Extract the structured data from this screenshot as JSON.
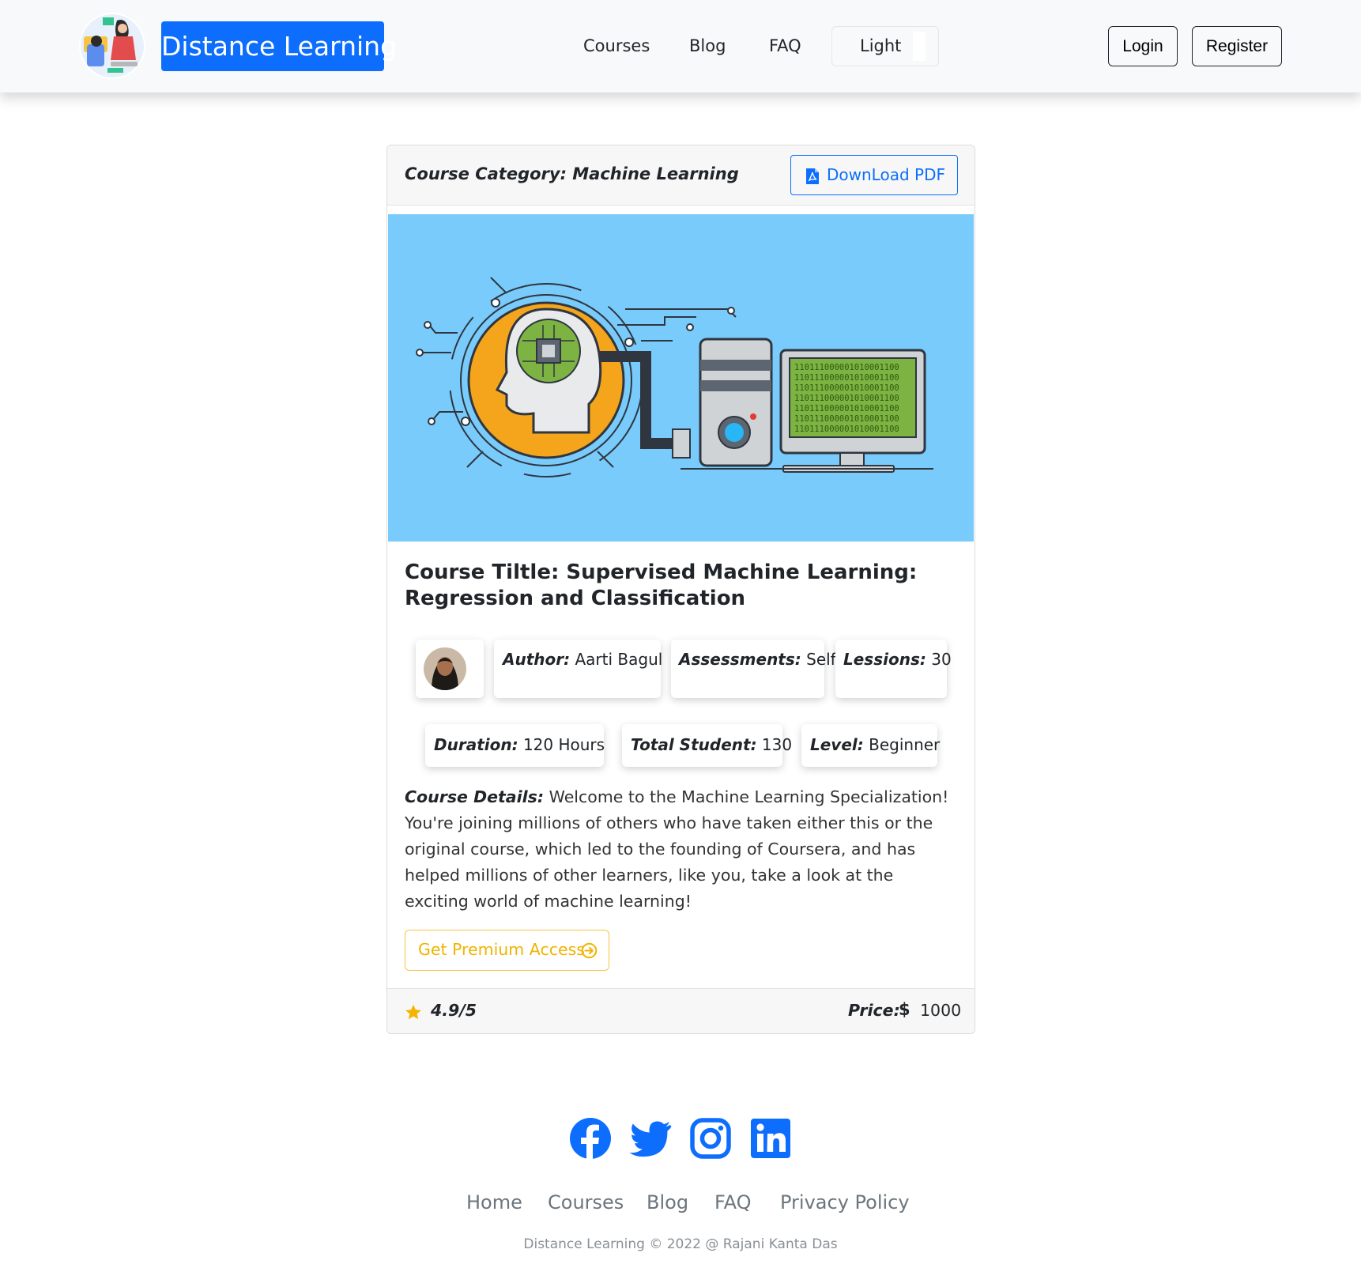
{
  "navbar": {
    "brand": "Distance Learning",
    "links": [
      "Courses",
      "Blog",
      "FAQ"
    ],
    "theme_label": "Light",
    "login_label": "Login",
    "register_label": "Register"
  },
  "course": {
    "category_label": "Course Category: Machine Learning",
    "download_label": "DownLoad PDF",
    "title": "Course Tiltle: Supervised Machine Learning: Regression and Classification",
    "author_key": "Author:",
    "author_val": "Aarti Bagul",
    "assessments_key": "Assessments:",
    "assessments_val": "Self",
    "lessons_key": "Lessions:",
    "lessons_val": "30",
    "duration_key": "Duration:",
    "duration_val": "120 Hours",
    "students_key": "Total Student:",
    "students_val": "130",
    "level_key": "Level:",
    "level_val": "Beginner",
    "details_key": "Course Details:",
    "details_text": "Welcome to the Machine Learning Specialization! You're joining millions of others who have taken either this or the original course, which led to the founding of Coursera, and has helped millions of other learners, like you, take a look at the exciting world of machine learning!",
    "premium_label": "Get Premium Access",
    "rating": "4.9/5",
    "price_key": "Price:",
    "price_val": "1000",
    "binary_lines": [
      "110111000001010001100",
      "110111000001010001100",
      "110111000001010001100",
      "110111000001010001100",
      "110111000001010001100",
      "110111000001010001100",
      "110111000001010001100"
    ]
  },
  "footer": {
    "links": [
      "Home",
      "Courses",
      "Blog",
      "FAQ",
      "Privacy Policy"
    ],
    "copyright": "Distance Learning © 2022 @ Rajani Kanta Das"
  },
  "colors": {
    "primary": "#0d6efd",
    "warning": "#f0b400",
    "hero_bg": "#79cbfb",
    "nav_bg": "#f8f9fa"
  },
  "icons": {
    "social": [
      "facebook-icon",
      "twitter-icon",
      "instagram-icon",
      "linkedin-icon"
    ]
  }
}
